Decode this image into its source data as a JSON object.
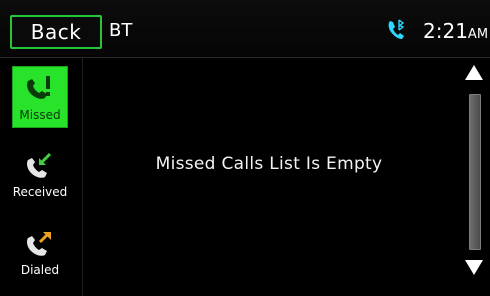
{
  "header": {
    "back_label": "Back",
    "source": "BT",
    "time": "2:21",
    "ampm": "AM"
  },
  "tabs": [
    {
      "label": "Missed",
      "icon": "missed-call-icon",
      "active": true
    },
    {
      "label": "Received",
      "icon": "received-call-icon",
      "active": false
    },
    {
      "label": "Dialed",
      "icon": "dialed-call-icon",
      "active": false
    }
  ],
  "main": {
    "message": "Missed Calls List Is Empty"
  },
  "colors": {
    "accent": "#27e42b",
    "background": "#000000",
    "bt_icon": "#2bd9ff"
  }
}
